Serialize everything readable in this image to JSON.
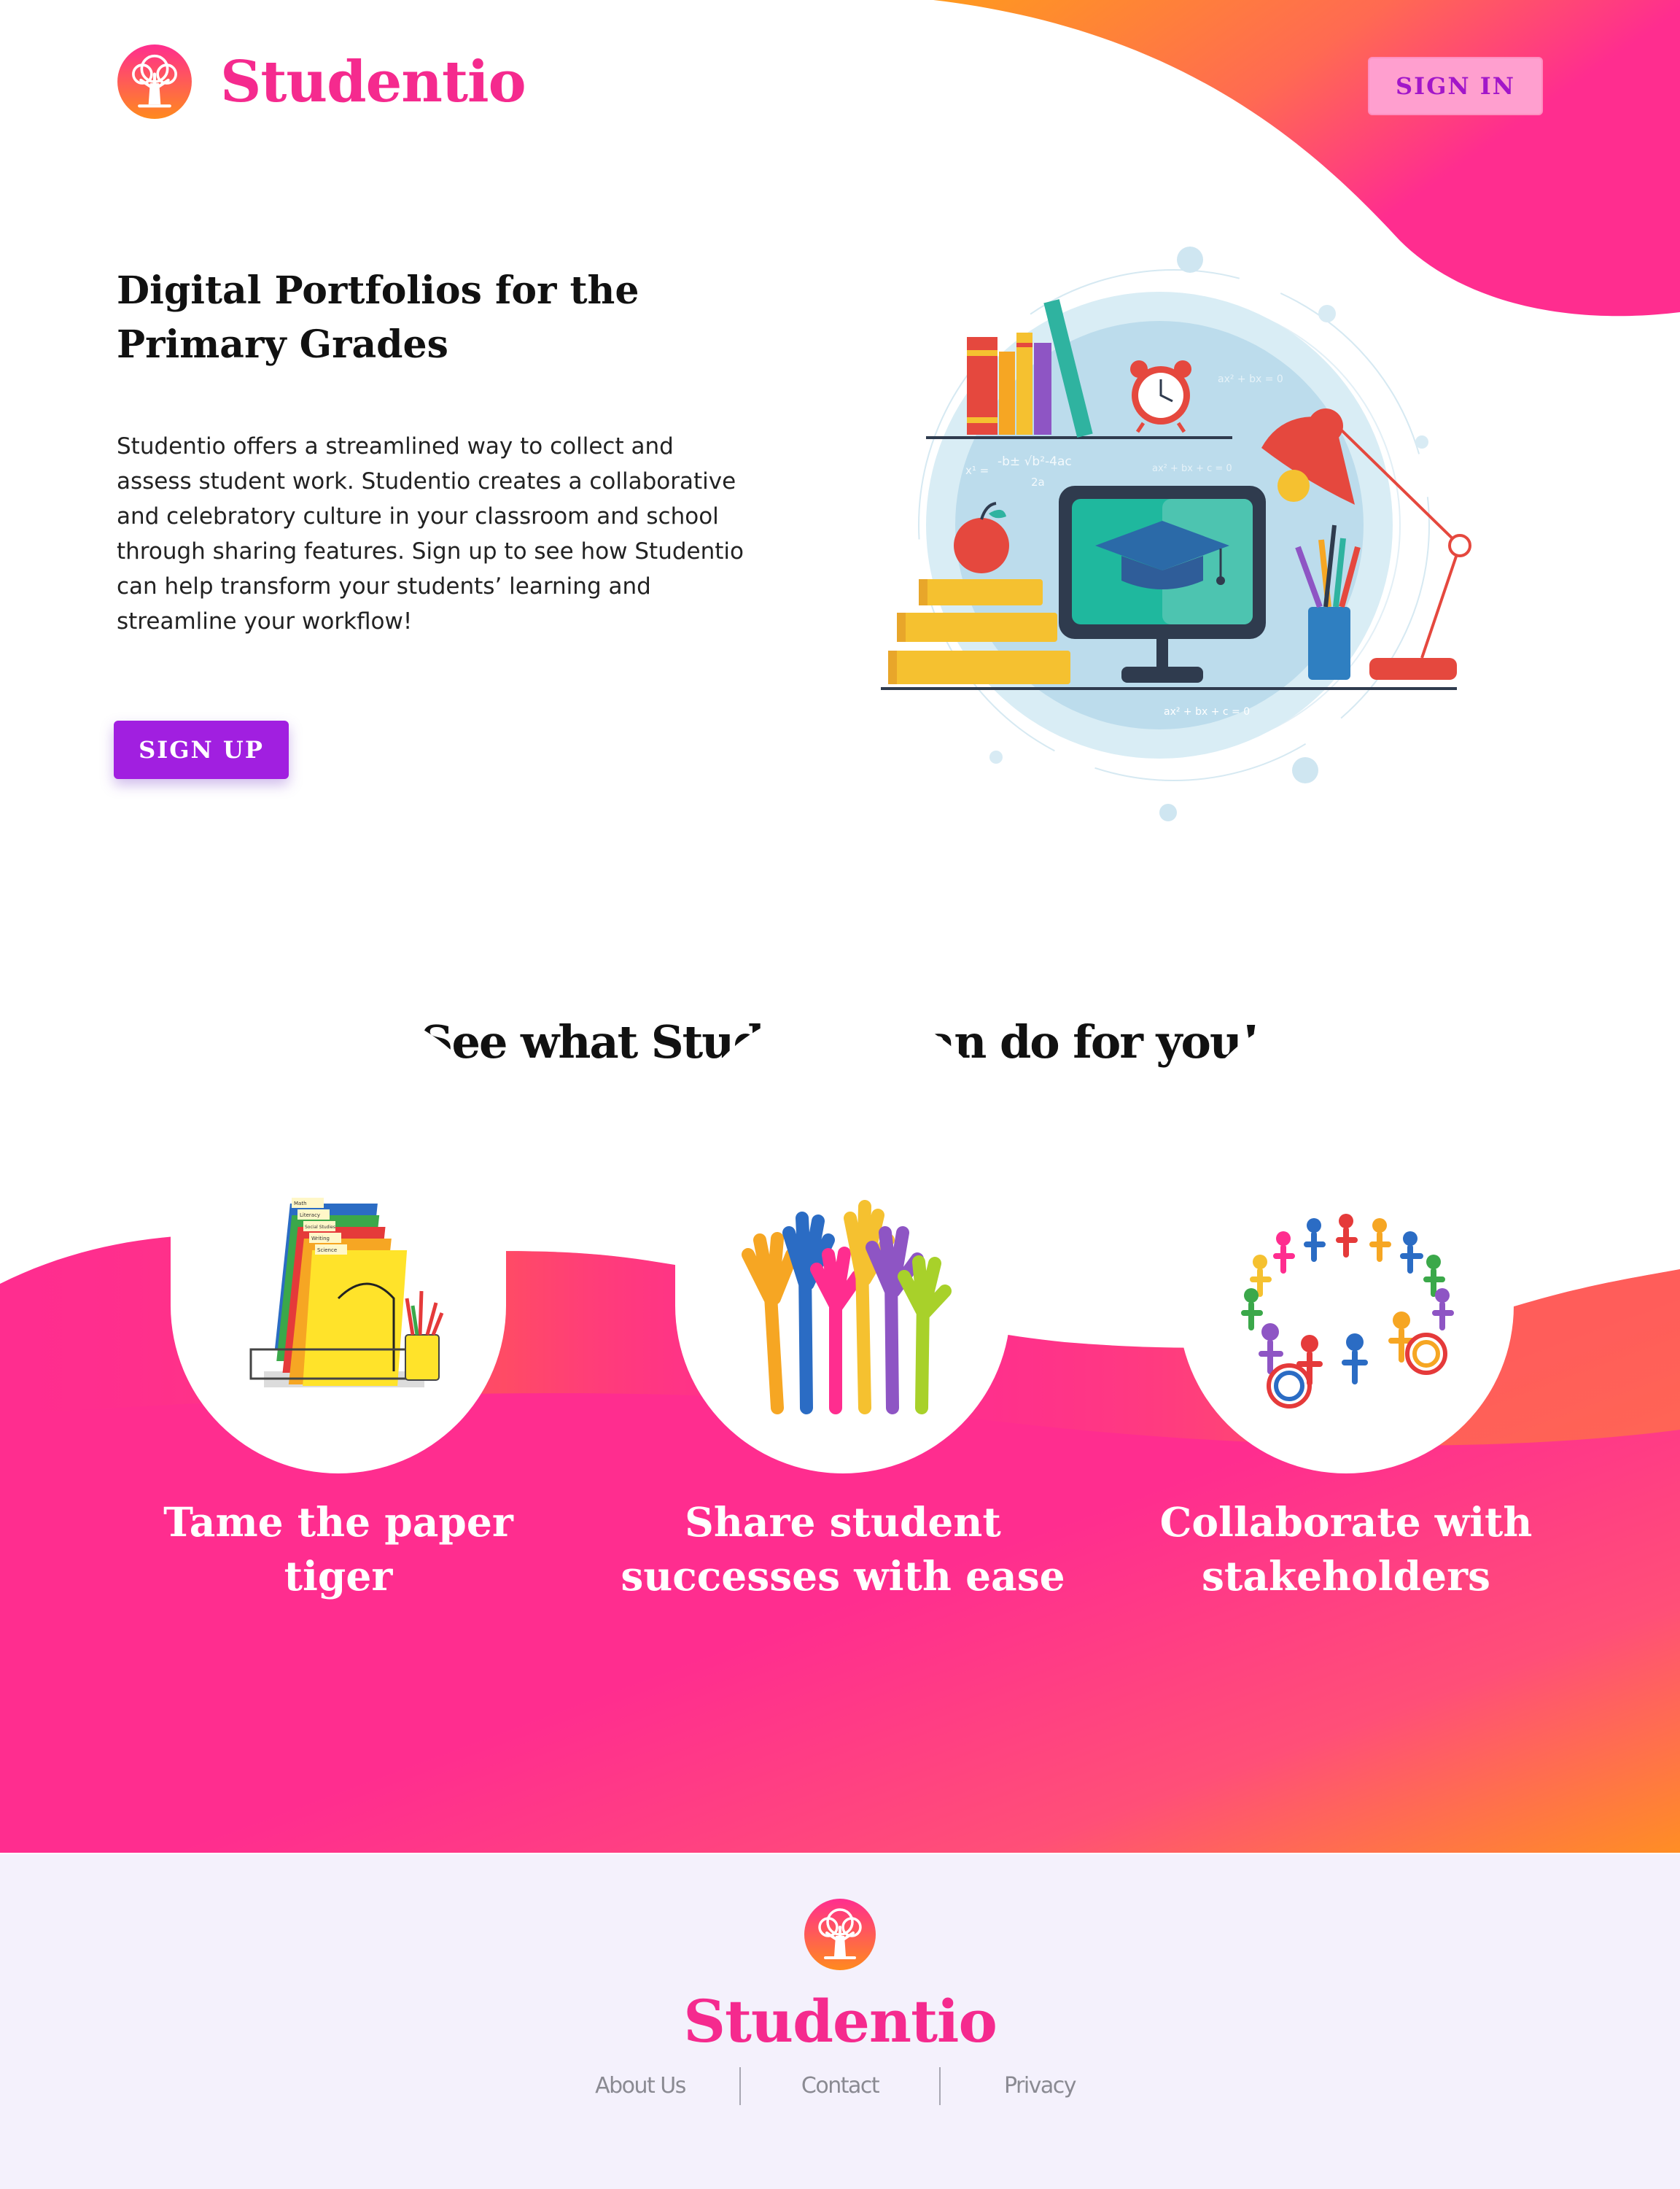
{
  "header": {
    "brand": "Studentio",
    "signin_label": "SIGN IN"
  },
  "hero": {
    "title_line1": "Digital Portfolios for the",
    "title_line2": "Primary Grades",
    "body": "Studentio offers a streamlined way to collect and assess student work. Studentio creates a collaborative and celebratory culture in your classroom and school through sharing features. Sign up to see how Studentio can help transform your students’ learning and streamline your workflow!",
    "signup_label": "SIGN UP",
    "illustration_formulas": [
      "ax² + bx = 0",
      "-b± √b²-4ac",
      "2a",
      "ax² + bx + c = 0",
      "ax² + bx + c = 0",
      "x¹ ="
    ]
  },
  "features": {
    "section_title": "See what Studentio can do for you!",
    "items": [
      {
        "title_line1": "Tame the paper",
        "title_line2": "tiger",
        "icon": "file-organizer-icon",
        "folder_tabs": [
          "Math",
          "Literacy",
          "Social Studies",
          "Writing",
          "Science"
        ]
      },
      {
        "title_line1": "Share student",
        "title_line2": "successes with ease",
        "icon": "raised-hands-icon"
      },
      {
        "title_line1": "Collaborate with",
        "title_line2": "stakeholders",
        "icon": "people-circle-icon"
      }
    ]
  },
  "footer": {
    "brand": "Studentio",
    "links": [
      "About Us",
      "Contact",
      "Privacy"
    ]
  },
  "colors": {
    "brand_pink": "#f52a8e",
    "accent_orange": "#ff8a1e",
    "button_purple": "#a11fe0",
    "signin_bg": "#ff9fcf",
    "footer_bg": "#f4f1fc"
  }
}
